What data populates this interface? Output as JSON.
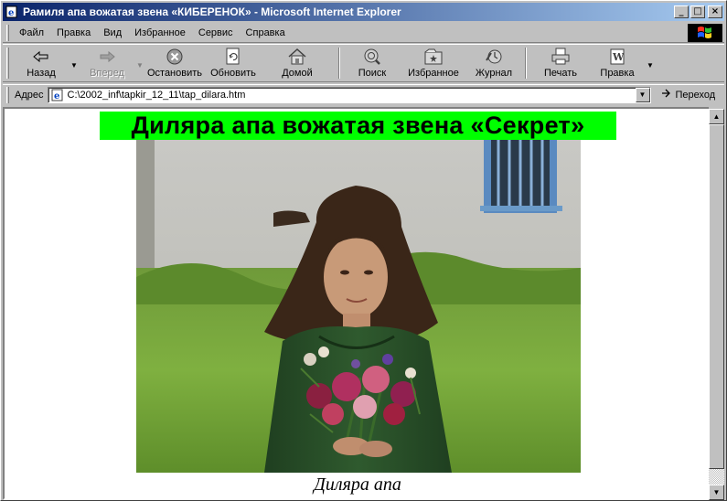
{
  "window": {
    "title": "Рамиля апа вожатая звена «КИБЕРЕНОК» - Microsoft Internet Explorer",
    "buttons": {
      "minimize": "_",
      "maximize": "□",
      "close": "×"
    }
  },
  "menu": {
    "items": [
      {
        "label": "Файл"
      },
      {
        "label": "Правка"
      },
      {
        "label": "Вид"
      },
      {
        "label": "Избранное"
      },
      {
        "label": "Сервис"
      },
      {
        "label": "Справка"
      }
    ]
  },
  "toolbar": {
    "back": "Назад",
    "forward": "Вперед",
    "stop": "Остановить",
    "refresh": "Обновить",
    "home": "Домой",
    "search": "Поиск",
    "favorites": "Избранное",
    "history": "Журнал",
    "print": "Печать",
    "edit": "Правка"
  },
  "address": {
    "label": "Адрес",
    "value": "C:\\2002_inf\\tapkir_12_11\\tap_dilara.htm",
    "go": "Переход"
  },
  "page": {
    "heading": "Диляра апа вожатая звена «Секрет»",
    "caption": "Диляра апа",
    "heading_bg": "#00ff00"
  },
  "icons": {
    "ie": "ie-page-icon",
    "back": "back-arrow-icon",
    "forward": "forward-arrow-icon",
    "stop": "stop-icon",
    "refresh": "refresh-icon",
    "home": "home-icon",
    "search": "search-globe-icon",
    "favorites": "favorites-icon",
    "history": "history-icon",
    "print": "printer-icon",
    "edit": "edit-icon"
  }
}
